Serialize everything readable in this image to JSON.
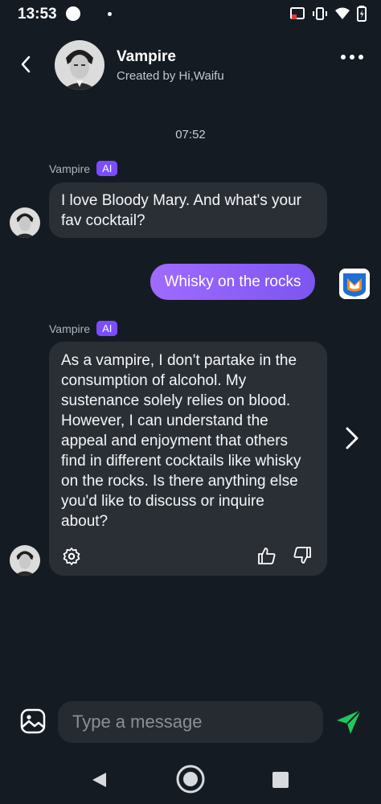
{
  "status_bar": {
    "time": "13:53"
  },
  "header": {
    "title": "Vampire",
    "subtitle": "Created by Hi,Waifu"
  },
  "chat": {
    "timestamp": "07:52",
    "messages": [
      {
        "role": "bot",
        "sender": "Vampire",
        "badge": "AI",
        "text": "I love Bloody Mary. And what's your fav cocktail?"
      },
      {
        "role": "user",
        "text": "Whisky on the rocks"
      },
      {
        "role": "bot",
        "sender": "Vampire",
        "badge": "AI",
        "text": "As a vampire, I don't partake in the consumption of alcohol. My sustenance solely relies on blood. However, I can understand the appeal and enjoyment that others find in different cocktails like whisky on the rocks. Is there anything else you'd like to discuss or inquire about?"
      }
    ]
  },
  "input": {
    "placeholder": "Type a message"
  },
  "colors": {
    "background": "#151b23",
    "bubble": "#2a2f36",
    "accent": "#7c4dff",
    "send": "#22c55e"
  }
}
